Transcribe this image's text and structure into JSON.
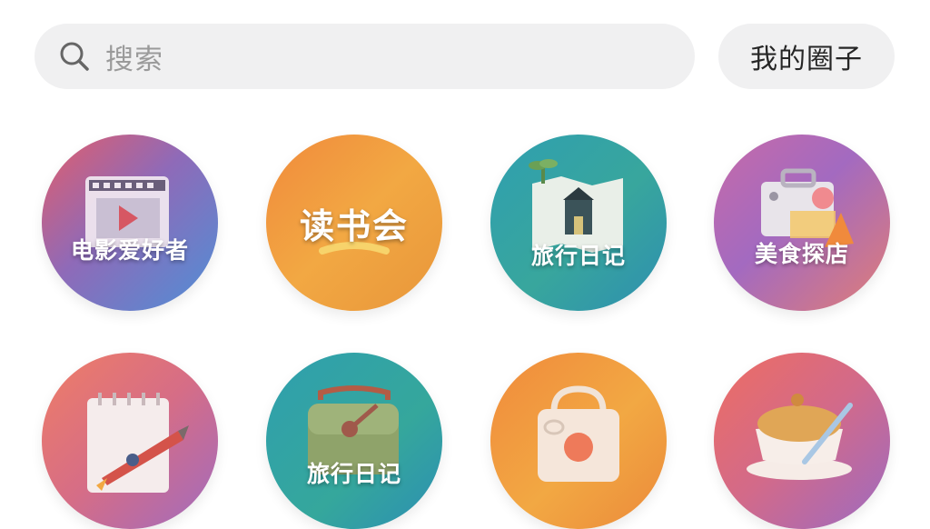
{
  "search": {
    "placeholder": "搜索"
  },
  "header": {
    "my_circles_label": "我的圈子"
  },
  "tiles": [
    {
      "label": "电影爱好者",
      "icon": "film-strip-icon"
    },
    {
      "label": "读书会",
      "icon": "smile-underline-icon"
    },
    {
      "label": "旅行日记",
      "icon": "travel-map-icon"
    },
    {
      "label": "美食探店",
      "icon": "shop-camera-icon"
    },
    {
      "label": "",
      "icon": "notebook-pen-icon"
    },
    {
      "label": "旅行日记",
      "icon": "backpack-icon"
    },
    {
      "label": "",
      "icon": "tote-bag-icon"
    },
    {
      "label": "",
      "icon": "food-bowl-fork-icon"
    }
  ],
  "colors": {
    "search_bg": "#f0f0f1",
    "placeholder": "#9a9a9a",
    "text": "#262626"
  }
}
